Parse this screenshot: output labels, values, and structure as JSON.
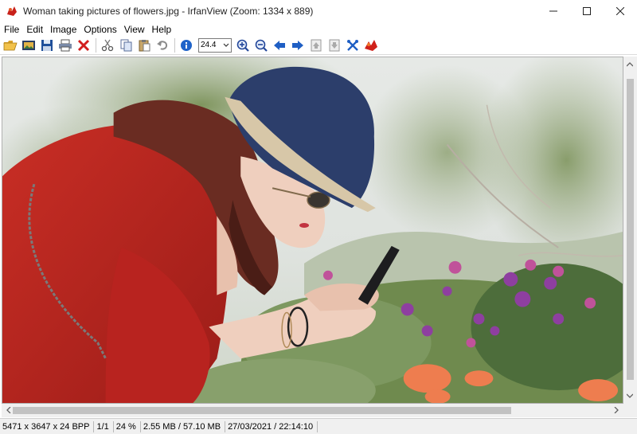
{
  "window": {
    "title": "Woman taking pictures of flowers.jpg - IrfanView (Zoom: 1334 x 889)"
  },
  "menu": [
    "File",
    "Edit",
    "Image",
    "Options",
    "View",
    "Help"
  ],
  "toolbar": {
    "zoom_value": "24.4",
    "icons": [
      "open-folder-icon",
      "slideshow-icon",
      "save-icon",
      "print-icon",
      "delete-icon",
      "cut-icon",
      "copy-icon",
      "paste-icon",
      "undo-icon",
      "info-icon",
      "zoom-in-icon",
      "zoom-out-icon",
      "previous-arrow-icon",
      "next-arrow-icon",
      "page-up-icon",
      "page-down-icon",
      "settings-icon",
      "irfanview-logo-icon"
    ]
  },
  "status": {
    "dimensions": "5471 x 3647 x 24 BPP",
    "page": "1/1",
    "zoom": "24 %",
    "memory": "2.55 MB / 57.10 MB",
    "datetime": "27/03/2021 / 22:14:10"
  },
  "scroll": {
    "vertical_position": 0.05,
    "horizontal_position": 0.02
  },
  "colors": {
    "sweater": "#b8231f",
    "hat": "#2c3e6b",
    "foliage": "#6f8a4e",
    "sky": "#e9ecec"
  }
}
